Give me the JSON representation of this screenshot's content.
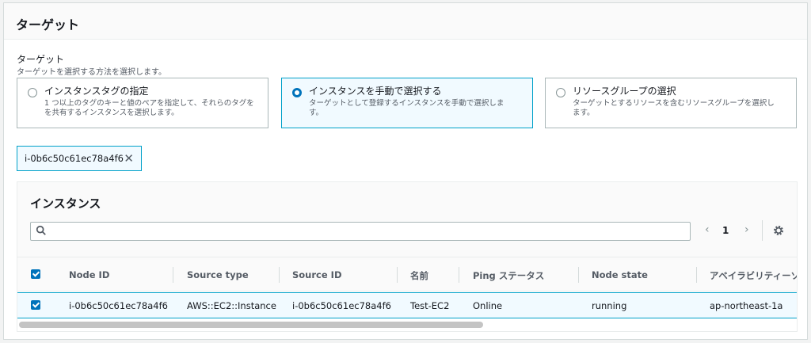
{
  "panel": {
    "title": "ターゲット"
  },
  "field": {
    "label": "ターゲット",
    "description": "ターゲットを選択する方法を選択します。"
  },
  "tiles": [
    {
      "title": "インスタンスタグの指定",
      "desc1": "1 つ以上のタグのキーと値のペアを指定して、それらのタグを",
      "desc2": "を共有するインスタンスを選択します。",
      "selected": false
    },
    {
      "title": "インスタンスを手動で選択する",
      "desc1": "ターゲットとして登録するインスタンスを手動で選択しま",
      "desc2": "す。",
      "selected": true
    },
    {
      "title": "リソースグループの選択",
      "desc1": "ターゲットとするリソースを含むリソースグループを選択し",
      "desc2": "ます。",
      "selected": false
    }
  ],
  "token": {
    "label": "i-0b6c50c61ec78a4f6"
  },
  "instances": {
    "title": "インスタンス",
    "search_value": "",
    "page": "1",
    "columns": [
      "Node ID",
      "Source type",
      "Source ID",
      "名前",
      "Ping ステータス",
      "Node state",
      "アベイラビリティーゾ"
    ],
    "rows": [
      [
        "i-0b6c50c61ec78a4f6",
        "AWS::EC2::Instance",
        "i-0b6c50c61ec78a4f6",
        "Test-EC2",
        "Online",
        "running",
        "ap-northeast-1a"
      ]
    ]
  },
  "colors": {
    "accent": "#0073bb",
    "selected_bg": "#f1faff",
    "selected_border": "#00a1c9"
  }
}
